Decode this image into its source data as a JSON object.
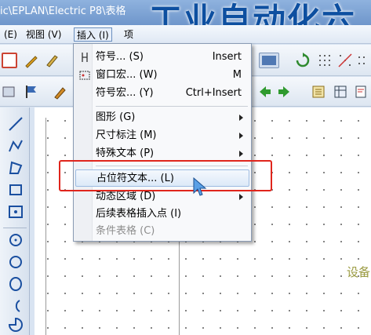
{
  "window": {
    "title": "ic\\EPLAN\\Electric P8\\表格",
    "overlay_title": "工业自动化六"
  },
  "menubar": {
    "items": [
      {
        "label": "(E)"
      },
      {
        "label": "视图 (V)"
      },
      {
        "label": "插入 (I)"
      },
      {
        "label": "项"
      }
    ]
  },
  "insert_menu": {
    "items": [
      {
        "label": "符号... (S)",
        "shortcut": "Insert",
        "icon": "symbol-icon"
      },
      {
        "label": "窗口宏... (W)",
        "shortcut": "M",
        "icon": "window-macro-icon"
      },
      {
        "label": "符号宏... (Y)",
        "shortcut": "Ctrl+Insert",
        "icon": ""
      },
      {
        "label": "图形 (G)",
        "submenu": true
      },
      {
        "label": "尺寸标注 (M)",
        "submenu": true
      },
      {
        "label": "特殊文本 (P)",
        "submenu": true
      },
      {
        "label": "占位符文本... (L)",
        "highlighted": true
      },
      {
        "label": "动态区域 (D)",
        "submenu": true
      },
      {
        "label": "后续表格插入点 (I)"
      },
      {
        "label": "条件表格 (C)",
        "disabled": true
      }
    ]
  },
  "canvas": {
    "device_text": "设备"
  },
  "colors": {
    "accent": "#e0251c",
    "titlebar": "#7aa0d4",
    "overlay_text": "#0d4fa0"
  }
}
